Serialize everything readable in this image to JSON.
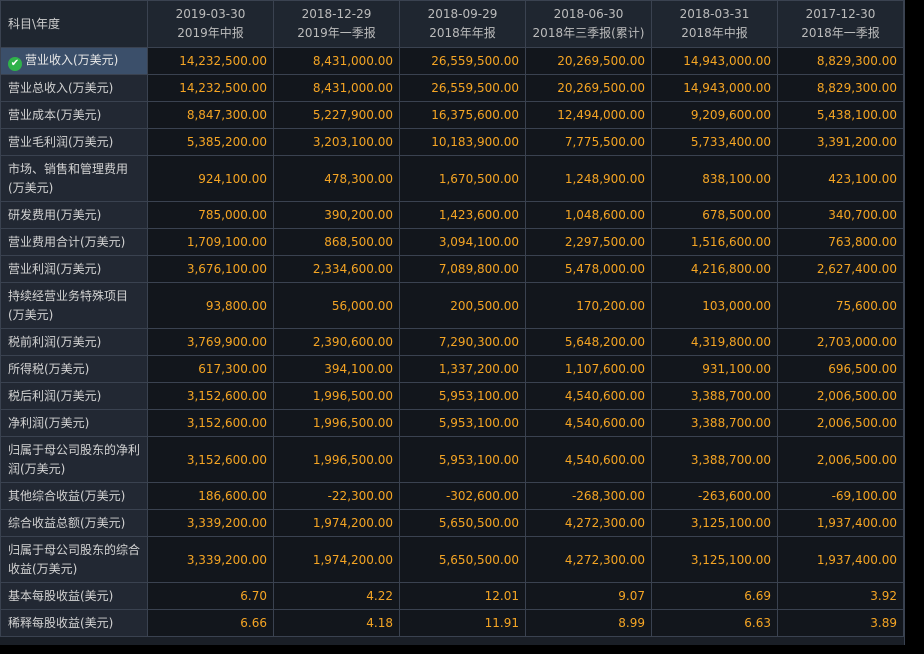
{
  "table": {
    "corner_label": "科目\\年度",
    "columns": [
      {
        "date": "2019-03-30",
        "period": "2019年中报"
      },
      {
        "date": "2018-12-29",
        "period": "2019年一季报"
      },
      {
        "date": "2018-09-29",
        "period": "2018年年报"
      },
      {
        "date": "2018-06-30",
        "period": "2018年三季报(累计)"
      },
      {
        "date": "2018-03-31",
        "period": "2018年中报"
      },
      {
        "date": "2017-12-30",
        "period": "2018年一季报"
      }
    ],
    "rows": [
      {
        "label": "营业收入(万美元)",
        "values": [
          "14,232,500.00",
          "8,431,000.00",
          "26,559,500.00",
          "20,269,500.00",
          "14,943,000.00",
          "8,829,300.00"
        ]
      },
      {
        "label": "营业总收入(万美元)",
        "values": [
          "14,232,500.00",
          "8,431,000.00",
          "26,559,500.00",
          "20,269,500.00",
          "14,943,000.00",
          "8,829,300.00"
        ]
      },
      {
        "label": "营业成本(万美元)",
        "values": [
          "8,847,300.00",
          "5,227,900.00",
          "16,375,600.00",
          "12,494,000.00",
          "9,209,600.00",
          "5,438,100.00"
        ]
      },
      {
        "label": "营业毛利润(万美元)",
        "values": [
          "5,385,200.00",
          "3,203,100.00",
          "10,183,900.00",
          "7,775,500.00",
          "5,733,400.00",
          "3,391,200.00"
        ]
      },
      {
        "label": "市场、销售和管理费用(万美元)",
        "values": [
          "924,100.00",
          "478,300.00",
          "1,670,500.00",
          "1,248,900.00",
          "838,100.00",
          "423,100.00"
        ]
      },
      {
        "label": "研发费用(万美元)",
        "values": [
          "785,000.00",
          "390,200.00",
          "1,423,600.00",
          "1,048,600.00",
          "678,500.00",
          "340,700.00"
        ]
      },
      {
        "label": "营业费用合计(万美元)",
        "values": [
          "1,709,100.00",
          "868,500.00",
          "3,094,100.00",
          "2,297,500.00",
          "1,516,600.00",
          "763,800.00"
        ]
      },
      {
        "label": "营业利润(万美元)",
        "values": [
          "3,676,100.00",
          "2,334,600.00",
          "7,089,800.00",
          "5,478,000.00",
          "4,216,800.00",
          "2,627,400.00"
        ]
      },
      {
        "label": "持续经营业务特殊项目(万美元)",
        "values": [
          "93,800.00",
          "56,000.00",
          "200,500.00",
          "170,200.00",
          "103,000.00",
          "75,600.00"
        ]
      },
      {
        "label": "税前利润(万美元)",
        "values": [
          "3,769,900.00",
          "2,390,600.00",
          "7,290,300.00",
          "5,648,200.00",
          "4,319,800.00",
          "2,703,000.00"
        ]
      },
      {
        "label": "所得税(万美元)",
        "values": [
          "617,300.00",
          "394,100.00",
          "1,337,200.00",
          "1,107,600.00",
          "931,100.00",
          "696,500.00"
        ]
      },
      {
        "label": "税后利润(万美元)",
        "values": [
          "3,152,600.00",
          "1,996,500.00",
          "5,953,100.00",
          "4,540,600.00",
          "3,388,700.00",
          "2,006,500.00"
        ]
      },
      {
        "label": "净利润(万美元)",
        "values": [
          "3,152,600.00",
          "1,996,500.00",
          "5,953,100.00",
          "4,540,600.00",
          "3,388,700.00",
          "2,006,500.00"
        ]
      },
      {
        "label": "归属于母公司股东的净利润(万美元)",
        "values": [
          "3,152,600.00",
          "1,996,500.00",
          "5,953,100.00",
          "4,540,600.00",
          "3,388,700.00",
          "2,006,500.00"
        ]
      },
      {
        "label": "其他综合收益(万美元)",
        "values": [
          "186,600.00",
          "-22,300.00",
          "-302,600.00",
          "-268,300.00",
          "-263,600.00",
          "-69,100.00"
        ]
      },
      {
        "label": "综合收益总额(万美元)",
        "values": [
          "3,339,200.00",
          "1,974,200.00",
          "5,650,500.00",
          "4,272,300.00",
          "3,125,100.00",
          "1,937,400.00"
        ]
      },
      {
        "label": "归属于母公司股东的综合收益(万美元)",
        "values": [
          "3,339,200.00",
          "1,974,200.00",
          "5,650,500.00",
          "4,272,300.00",
          "3,125,100.00",
          "1,937,400.00"
        ]
      },
      {
        "label": "基本每股收益(美元)",
        "values": [
          "6.70",
          "4.22",
          "12.01",
          "9.07",
          "6.69",
          "3.92"
        ]
      },
      {
        "label": "稀释每股收益(美元)",
        "values": [
          "6.66",
          "4.18",
          "11.91",
          "8.99",
          "6.63",
          "3.89"
        ]
      }
    ]
  }
}
